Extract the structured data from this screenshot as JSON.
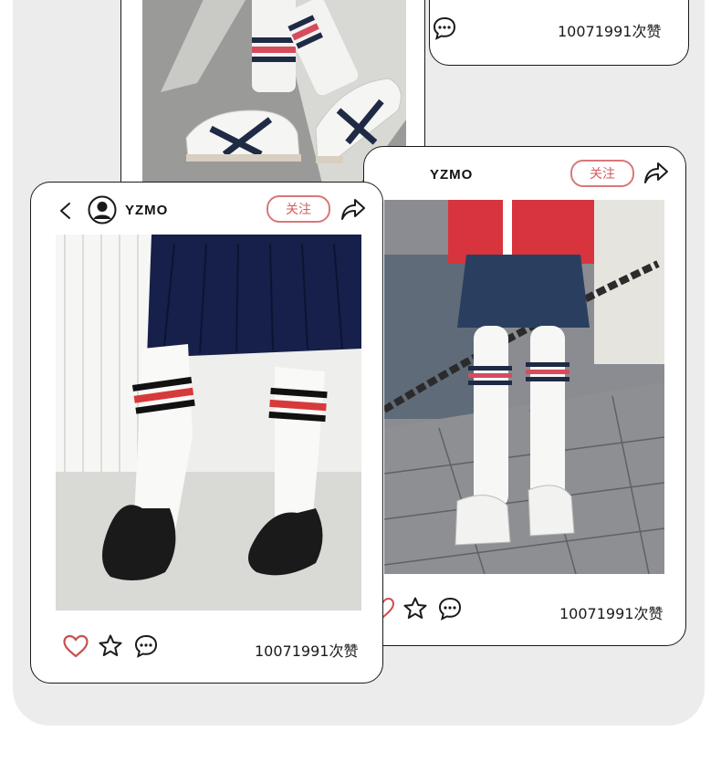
{
  "cards": {
    "back_top": {
      "likes_text": "10071991次赞"
    },
    "back_mid": {
      "partial_likes_text": "次赞"
    },
    "right": {
      "username": "YZMO",
      "follow_label": "关注",
      "likes_text": "10071991次赞"
    },
    "front": {
      "username": "YZMO",
      "follow_label": "关注",
      "likes_text": "10071991次赞"
    }
  },
  "icons": {
    "back": "back-icon",
    "avatar": "avatar-icon",
    "share": "share-icon",
    "like": "heart-icon",
    "favorite": "star-icon",
    "comment": "comment-icon"
  },
  "colors": {
    "accent": "#d65c5f",
    "heart": "#c9504f",
    "border": "#1a1a1a",
    "panel": "#ececec"
  }
}
